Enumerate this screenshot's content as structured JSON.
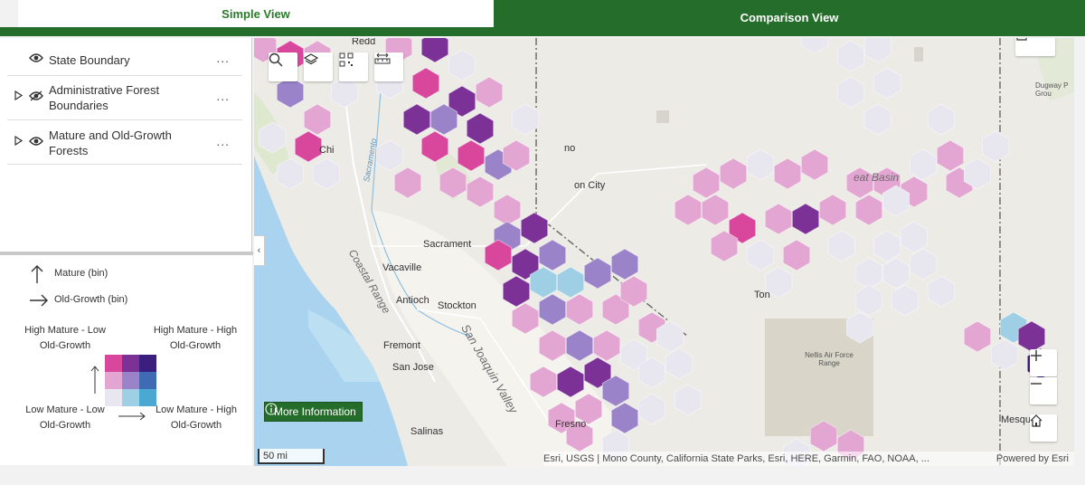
{
  "tabs": {
    "simple": "Simple View",
    "comparison": "Comparison View"
  },
  "layers": [
    {
      "label": "State Boundary",
      "expandable": false,
      "more": "..."
    },
    {
      "label": "Administrative Forest Boundaries",
      "expandable": true,
      "more": "..."
    },
    {
      "label": "Mature and Old-Growth Forests",
      "expandable": true,
      "more": "..."
    }
  ],
  "legend": {
    "mature_bin": "Mature (bin)",
    "old_growth_bin": "Old-Growth (bin)",
    "high_mature_low_og": "High Mature - Low Old-Growth",
    "high_mature_high_og": "High Mature - High Old-Growth",
    "low_mature_low_og": "Low Mature - Low Old-Growth",
    "low_mature_high_og": "Low Mature - High Old-Growth",
    "matrix_colors": [
      [
        "#d9479d",
        "#7b3196",
        "#3a1f7e"
      ],
      [
        "#e3a6d2",
        "#9a83c8",
        "#3f6ab4"
      ],
      [
        "#e8e6ef",
        "#9fcfe4",
        "#4aa8d3"
      ]
    ]
  },
  "map": {
    "labels": {
      "redding": "Redd",
      "chico": "Chi",
      "reno": "no",
      "carson_city": "on City",
      "sacramento": "Sacrament",
      "vacaville": "Vacaville",
      "antioch": "Antioch",
      "stockton": "Stockton",
      "fremont": "Fremont",
      "san_jose": "San Jose",
      "salinas": "Salinas",
      "fresno": "Fresno",
      "tonopah": "Ton",
      "great_basin": "eat Basin",
      "nellis": "Nellis Air Force Range",
      "dugway": "Dugway P Grou",
      "mesquite": "Mesqu",
      "sacramento_river": "Sacramento",
      "coastal_range": "Coastal Range",
      "san_joaquin": "San Joaquin Valley"
    },
    "more_info": "More Information",
    "scale": "50 mi",
    "attribution": "Esri, USGS | Mono County, California State Parks, Esri, HERE, Garmin, FAO, NOAA, ...",
    "powered_by": "Powered by Esri",
    "icons": [
      "search-icon",
      "layers-icon",
      "qr-icon",
      "ruler-icon",
      "external-link-icon",
      "zoom-in-icon",
      "zoom-out-icon",
      "home-icon",
      "eye-icon",
      "caret-right-icon",
      "info-icon"
    ]
  }
}
